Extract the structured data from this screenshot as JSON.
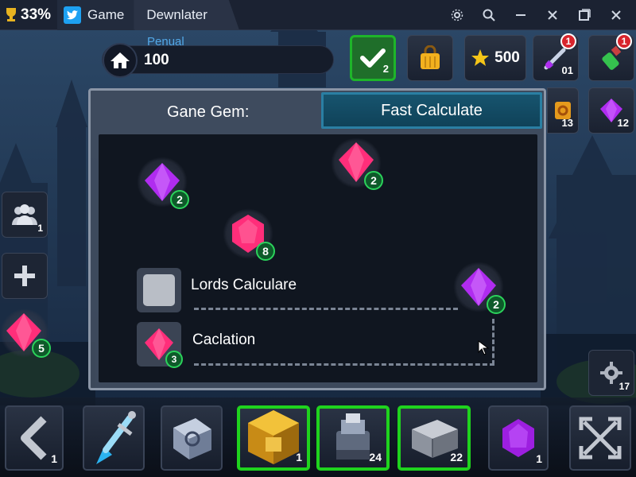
{
  "titlebar": {
    "trophy_icon": "trophy-icon",
    "percent": "33%",
    "tab_game": "Game",
    "tab_active": "Dewnlater",
    "controls": [
      "settings-icon",
      "search-icon",
      "minimize-icon",
      "close-icon",
      "maximize-icon",
      "close-icon"
    ]
  },
  "resources": {
    "home_label": "Penual",
    "home_value": "100",
    "check_count": "2",
    "star_value": "500",
    "sword_count": "01",
    "sword_badge": "1",
    "potion_badge": "1",
    "scroll_count": "13",
    "gem_count": "12"
  },
  "panel": {
    "title": "Gane Gem:",
    "fast_button": "Fast Calculate",
    "gems": [
      {
        "color": "purple",
        "count": "2"
      },
      {
        "color": "pink",
        "count": "2"
      },
      {
        "color": "pink",
        "count": "8"
      },
      {
        "color": "purple",
        "count": "2"
      }
    ],
    "rows": [
      {
        "label": "Lords Calculare"
      },
      {
        "label": "Caclation",
        "count": "3"
      }
    ]
  },
  "side": {
    "friends_count": "1",
    "add_label": "+",
    "gem_count": "5",
    "settings_count": "17"
  },
  "bottom": {
    "slots": [
      {
        "name": "back",
        "count": "1"
      },
      {
        "name": "sword",
        "count": ""
      },
      {
        "name": "cube",
        "count": ""
      },
      {
        "name": "chest",
        "count": "1",
        "selected": true
      },
      {
        "name": "anvil",
        "count": "24",
        "selected": true
      },
      {
        "name": "blocks",
        "count": "22",
        "selected": true
      },
      {
        "name": "purple-gem",
        "count": "1"
      },
      {
        "name": "expand",
        "count": ""
      }
    ]
  },
  "colors": {
    "accent_green": "#1fd31e",
    "button_teal": "#0f4259",
    "gem_pink": "#ff2e7a",
    "gem_purple": "#b02cf0",
    "badge_red": "#d8252d"
  }
}
